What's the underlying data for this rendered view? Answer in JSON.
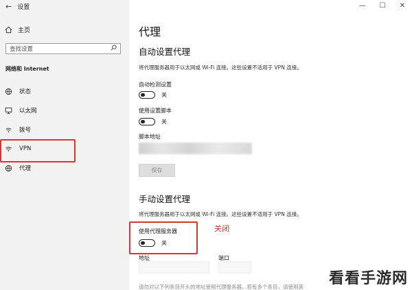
{
  "window": {
    "title": "设置",
    "controls": {
      "minimize": "—",
      "maximize": "☐",
      "close": "✕"
    }
  },
  "sidebar": {
    "home": "主页",
    "search_placeholder": "查找设置",
    "section": "网络和 Internet",
    "items": [
      {
        "label": "状态",
        "icon": "globe-status-icon"
      },
      {
        "label": "以太网",
        "icon": "monitor-icon"
      },
      {
        "label": "拨号",
        "icon": "dialup-icon"
      },
      {
        "label": "VPN",
        "icon": "vpn-icon"
      },
      {
        "label": "代理",
        "icon": "globe-icon"
      }
    ]
  },
  "main": {
    "title": "代理",
    "auto": {
      "heading": "自动设置代理",
      "description": "将代理服务器用于以太网或 Wi-Fi 连接。这些设置不适用于 VPN 连接。",
      "auto_detect_label": "自动检测设置",
      "auto_detect_state": "关",
      "use_script_label": "使用设置脚本",
      "use_script_state": "关",
      "script_address_label": "脚本地址",
      "save_button": "保存"
    },
    "manual": {
      "heading": "手动设置代理",
      "description": "将代理服务器用于以太网或 Wi-Fi 连接。这些设置不适用于 VPN 连接。",
      "use_proxy_label": "使用代理服务器",
      "use_proxy_state": "关",
      "address_label": "地址",
      "port_label": "端口",
      "footer": "请勿对以下列条目开头的地址使用代理服务器。若有多个条目，请使用英"
    },
    "annotation": "关闭"
  },
  "watermark": "看看手游网",
  "colors": {
    "highlight": "#d9362b",
    "sidebar_bg": "#f2f2f2"
  }
}
